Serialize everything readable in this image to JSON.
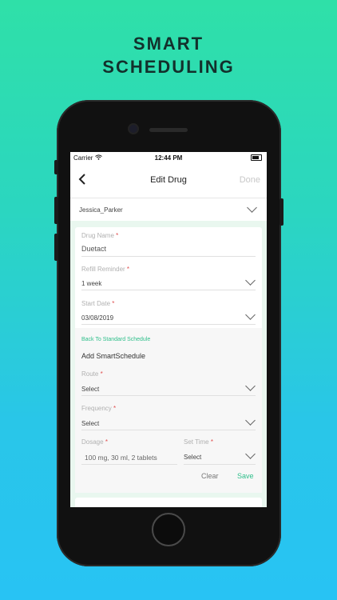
{
  "headline": {
    "line1": "SMART",
    "line2": "SCHEDULING"
  },
  "status_bar": {
    "carrier": "Carrier",
    "wifi_icon": "wifi-icon",
    "time": "12:44 PM",
    "battery_icon": "battery-icon"
  },
  "nav": {
    "back_icon": "chevron-left-icon",
    "title": "Edit Drug",
    "done": "Done"
  },
  "patient": {
    "value": "Jessica_Parker"
  },
  "form": {
    "drug_name": {
      "label": "Drug Name",
      "value": "Duetact"
    },
    "refill": {
      "label": "Refill Reminder",
      "value": "1 week"
    },
    "start_date": {
      "label": "Start Date",
      "value": "03/08/2019"
    },
    "back_link": "Back To Standard Schedule",
    "smart_heading": "Add SmartSchedule",
    "route": {
      "label": "Route",
      "value": "Select"
    },
    "frequency": {
      "label": "Frequency",
      "value": "Select"
    },
    "dosage": {
      "label": "Dosage",
      "placeholder": "100 mg, 30 ml, 2 tablets"
    },
    "set_time": {
      "label": "Set Time",
      "value": "Select"
    },
    "required_mark": "*",
    "clear": "Clear",
    "save": "Save"
  },
  "colors": {
    "accent": "#2fbf8b",
    "required": "#e05050",
    "headline": "#13302c"
  }
}
